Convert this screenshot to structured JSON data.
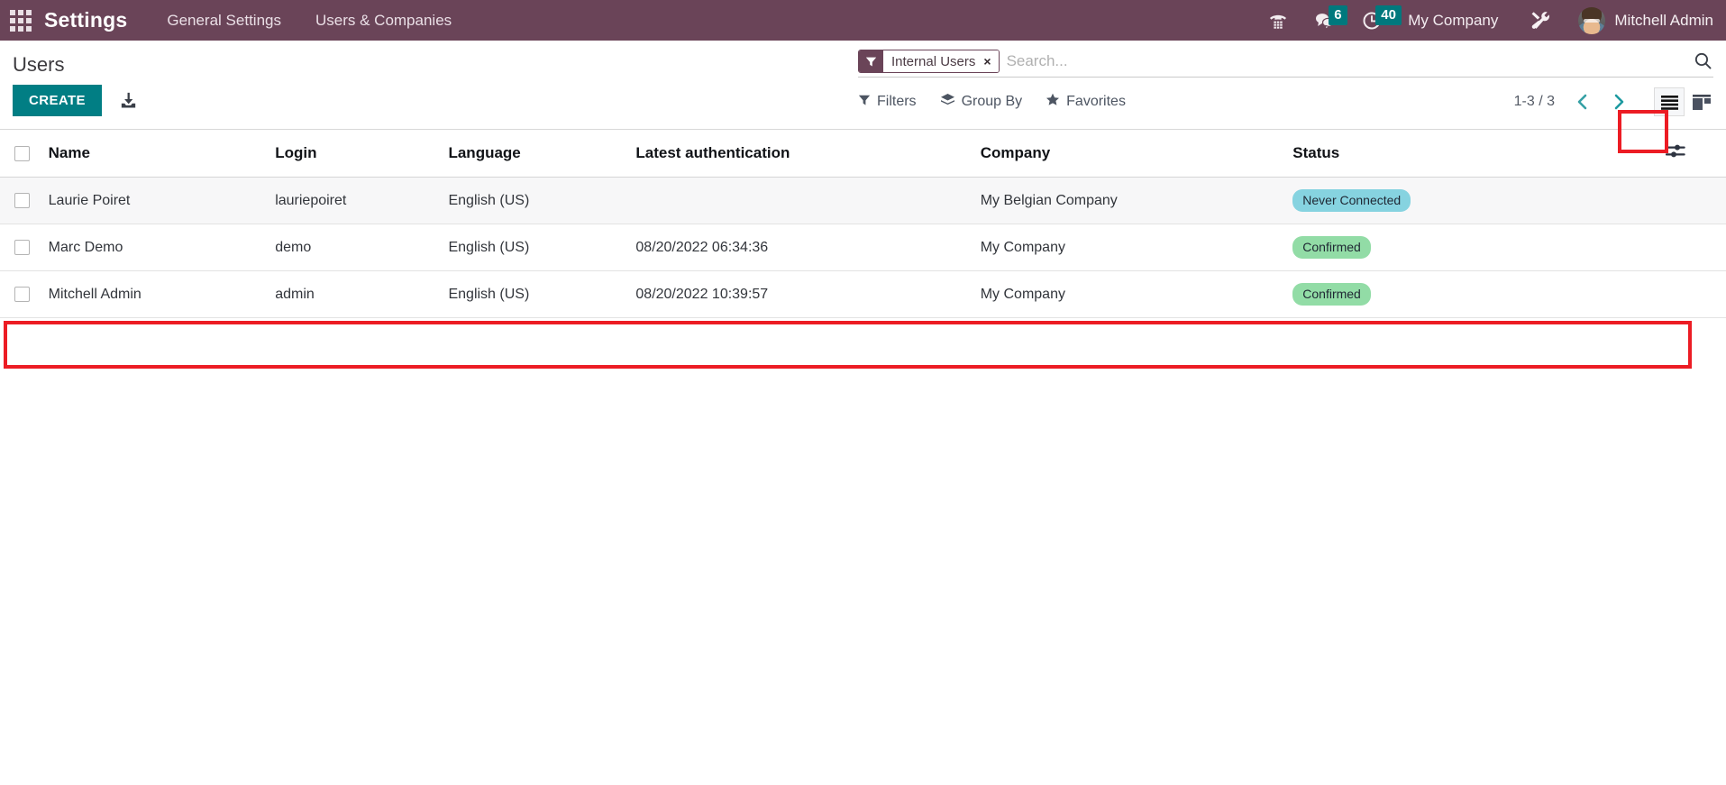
{
  "navbar": {
    "apps_icon": "apps-grid-icon",
    "brand": "Settings",
    "menu": [
      {
        "label": "General Settings"
      },
      {
        "label": "Users & Companies"
      }
    ],
    "systray": [
      {
        "icon": "phone-dialpad-icon",
        "badge": ""
      },
      {
        "icon": "messages-icon",
        "badge": "6"
      },
      {
        "icon": "activities-clock-icon",
        "badge": "40"
      }
    ],
    "company": "My Company",
    "tools_icon": "tools-wrench-icon",
    "user": "Mitchell Admin",
    "avatar_alt": "user-avatar"
  },
  "control_panel": {
    "title": "Users",
    "create_label": "CREATE",
    "export_icon": "download-export-icon",
    "search": {
      "facet_icon": "filter-funnel-icon",
      "facet_label": "Internal Users",
      "facet_remove": "×",
      "placeholder": "Search...",
      "value": "",
      "search_icon": "search-icon"
    },
    "dropdowns": [
      {
        "icon": "filter-funnel-icon",
        "label": "Filters"
      },
      {
        "icon": "group-by-layers-icon",
        "label": "Group By"
      },
      {
        "icon": "favorites-star-icon",
        "label": "Favorites"
      }
    ],
    "pager": {
      "range": "1-3 / 3",
      "prev_icon": "chevron-left-icon",
      "next_icon": "chevron-right-icon"
    },
    "views": [
      {
        "icon": "list-view-icon",
        "active": true
      },
      {
        "icon": "kanban-view-icon",
        "active": false
      }
    ]
  },
  "table": {
    "columns": [
      "Name",
      "Login",
      "Language",
      "Latest authentication",
      "Company",
      "Status"
    ],
    "optional_columns_icon": "optional-columns-sliders-icon",
    "rows": [
      {
        "name": "Laurie Poiret",
        "login": "lauriepoiret",
        "language": "English (US)",
        "latest_authentication": "",
        "company": "My Belgian Company",
        "status": "Never Connected",
        "status_type": "never"
      },
      {
        "name": "Marc Demo",
        "login": "demo",
        "language": "English (US)",
        "latest_authentication": "08/20/2022 06:34:36",
        "company": "My Company",
        "status": "Confirmed",
        "status_type": "confirmed"
      },
      {
        "name": "Mitchell Admin",
        "login": "admin",
        "language": "English (US)",
        "latest_authentication": "08/20/2022 10:39:57",
        "company": "My Company",
        "status": "Confirmed",
        "status_type": "confirmed"
      }
    ]
  },
  "colors": {
    "navbar_purple": "#6a4458",
    "accent_teal": "#017e84",
    "badge_teal": "#00787d",
    "annotation_red": "#ec1c24",
    "status_never": "#86d3e0",
    "status_confirmed": "#92dca6"
  }
}
